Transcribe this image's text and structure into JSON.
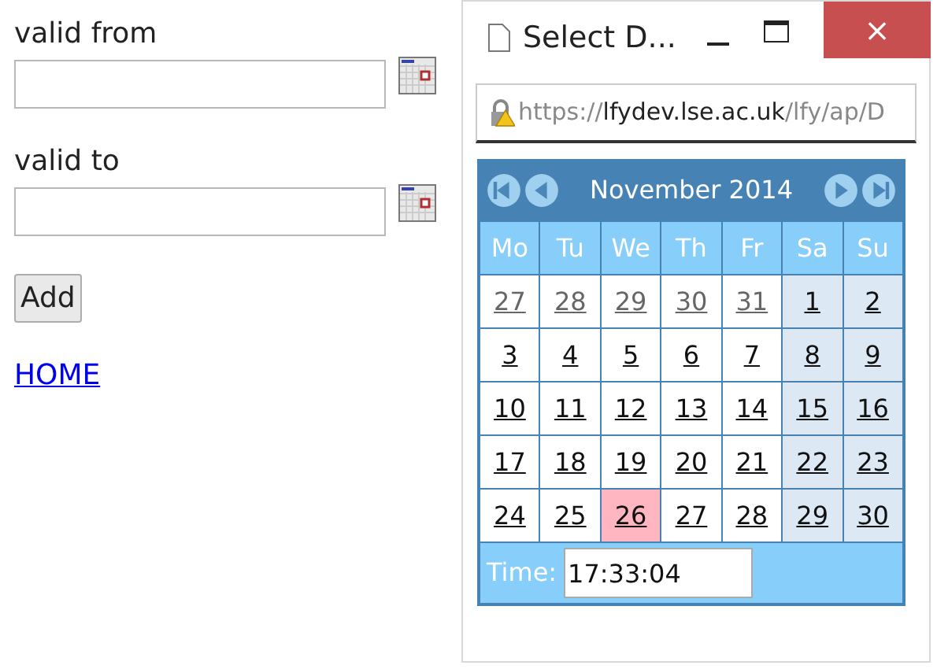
{
  "form": {
    "fields": [
      {
        "label": "valid from"
      },
      {
        "label": "valid to"
      }
    ],
    "button": "Add",
    "link": "HOME"
  },
  "popup": {
    "title": "Select D...",
    "close": "×",
    "url": {
      "scheme": "https://",
      "host": "lfydev.lse.ac.uk",
      "path": "/lfy/ap/D"
    },
    "calendar": {
      "month": "November 2014",
      "weekdays": [
        {
          "label": "Mo",
          "weekend": false
        },
        {
          "label": "Tu",
          "weekend": false
        },
        {
          "label": "We",
          "weekend": false
        },
        {
          "label": "Th",
          "weekend": false
        },
        {
          "label": "Fr",
          "weekend": false
        },
        {
          "label": "Sa",
          "weekend": true
        },
        {
          "label": "Su",
          "weekend": true
        }
      ],
      "weeks": [
        [
          {
            "label": "27",
            "other_month": true,
            "selected": false
          },
          {
            "label": "28",
            "other_month": true,
            "selected": false
          },
          {
            "label": "29",
            "other_month": true,
            "selected": false
          },
          {
            "label": "30",
            "other_month": true,
            "selected": false
          },
          {
            "label": "31",
            "other_month": true,
            "selected": false
          },
          {
            "label": "1",
            "other_month": false,
            "selected": false
          },
          {
            "label": "2",
            "other_month": false,
            "selected": false
          }
        ],
        [
          {
            "label": "3",
            "other_month": false,
            "selected": false
          },
          {
            "label": "4",
            "other_month": false,
            "selected": false
          },
          {
            "label": "5",
            "other_month": false,
            "selected": false
          },
          {
            "label": "6",
            "other_month": false,
            "selected": false
          },
          {
            "label": "7",
            "other_month": false,
            "selected": false
          },
          {
            "label": "8",
            "other_month": false,
            "selected": false
          },
          {
            "label": "9",
            "other_month": false,
            "selected": false
          }
        ],
        [
          {
            "label": "10",
            "other_month": false,
            "selected": false
          },
          {
            "label": "11",
            "other_month": false,
            "selected": false
          },
          {
            "label": "12",
            "other_month": false,
            "selected": false
          },
          {
            "label": "13",
            "other_month": false,
            "selected": false
          },
          {
            "label": "14",
            "other_month": false,
            "selected": false
          },
          {
            "label": "15",
            "other_month": false,
            "selected": false
          },
          {
            "label": "16",
            "other_month": false,
            "selected": false
          }
        ],
        [
          {
            "label": "17",
            "other_month": false,
            "selected": false
          },
          {
            "label": "18",
            "other_month": false,
            "selected": false
          },
          {
            "label": "19",
            "other_month": false,
            "selected": false
          },
          {
            "label": "20",
            "other_month": false,
            "selected": false
          },
          {
            "label": "21",
            "other_month": false,
            "selected": false
          },
          {
            "label": "22",
            "other_month": false,
            "selected": false
          },
          {
            "label": "23",
            "other_month": false,
            "selected": false
          }
        ],
        [
          {
            "label": "24",
            "other_month": false,
            "selected": false
          },
          {
            "label": "25",
            "other_month": false,
            "selected": false
          },
          {
            "label": "26",
            "other_month": false,
            "selected": true
          },
          {
            "label": "27",
            "other_month": false,
            "selected": false
          },
          {
            "label": "28",
            "other_month": false,
            "selected": false
          },
          {
            "label": "29",
            "other_month": false,
            "selected": false
          },
          {
            "label": "30",
            "other_month": false,
            "selected": false
          }
        ]
      ],
      "time_label": "Time:",
      "time_value": "17:33:04"
    }
  }
}
